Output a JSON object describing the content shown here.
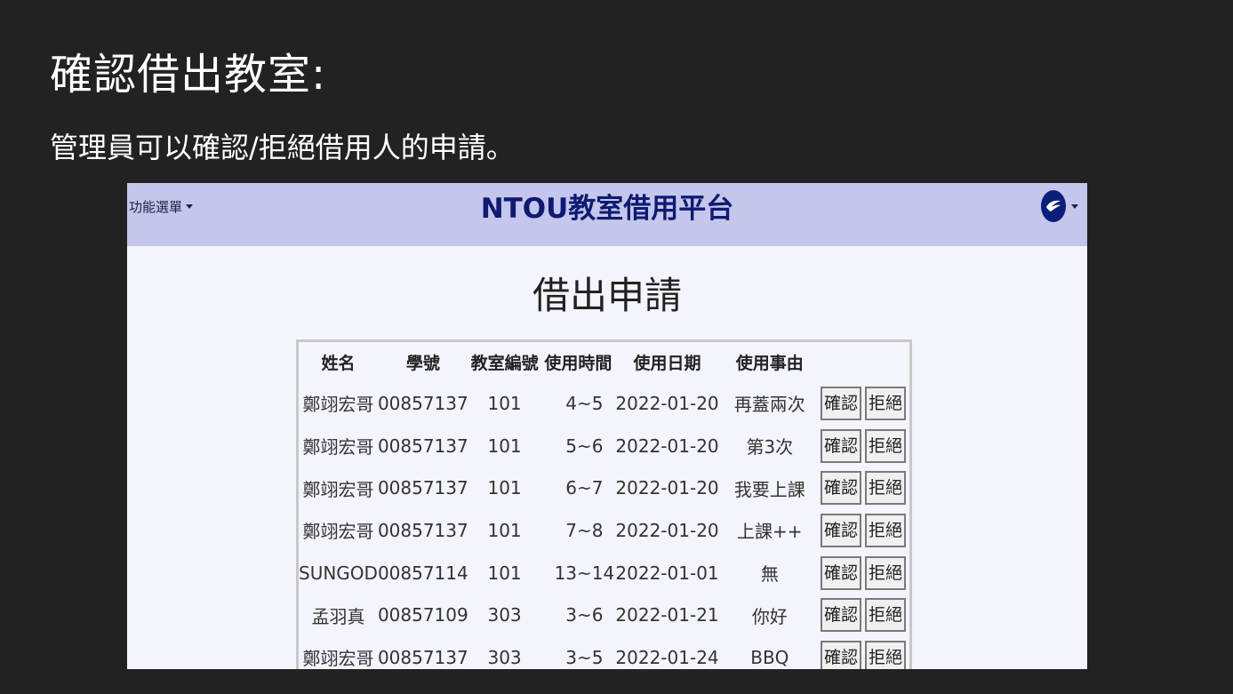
{
  "slide": {
    "title": "確認借出教室:",
    "subtitle": "管理員可以確認/拒絕借用人的申請。"
  },
  "app": {
    "menu_label": "功能選單",
    "brand": "NTOU教室借用平台",
    "user_icon": "ntou-logo-icon"
  },
  "page": {
    "heading": "借出申請"
  },
  "table": {
    "headers": [
      "姓名",
      "學號",
      "教室編號",
      "使用時間",
      "使用日期",
      "使用事由"
    ],
    "rows": [
      {
        "name": "鄭翊宏哥",
        "id": "00857137",
        "room": "101",
        "time": "4~5",
        "date": "2022-01-20",
        "reason": "再蓋兩次",
        "confirm": "確認",
        "reject": "拒絕"
      },
      {
        "name": "鄭翊宏哥",
        "id": "00857137",
        "room": "101",
        "time": "5~6",
        "date": "2022-01-20",
        "reason": "第3次",
        "confirm": "確認",
        "reject": "拒絕"
      },
      {
        "name": "鄭翊宏哥",
        "id": "00857137",
        "room": "101",
        "time": "6~7",
        "date": "2022-01-20",
        "reason": "我要上課",
        "confirm": "確認",
        "reject": "拒絕"
      },
      {
        "name": "鄭翊宏哥",
        "id": "00857137",
        "room": "101",
        "time": "7~8",
        "date": "2022-01-20",
        "reason": "上課++",
        "confirm": "確認",
        "reject": "拒絕"
      },
      {
        "name": "SUNGOD",
        "id": "00857114",
        "room": "101",
        "time": "13~14",
        "date": "2022-01-01",
        "reason": "無",
        "confirm": "確認",
        "reject": "拒絕"
      },
      {
        "name": "孟羽真",
        "id": "00857109",
        "room": "303",
        "time": "3~6",
        "date": "2022-01-21",
        "reason": "你好",
        "confirm": "確認",
        "reject": "拒絕"
      },
      {
        "name": "鄭翊宏哥",
        "id": "00857137",
        "room": "303",
        "time": "3~5",
        "date": "2022-01-24",
        "reason": "BBQ",
        "confirm": "確認",
        "reject": "拒絕"
      }
    ]
  },
  "colors": {
    "slide_bg": "#222222",
    "navbar_bg": "#c4c6ec",
    "brand": "#0f1a72",
    "content_bg": "#f4f4fd"
  }
}
